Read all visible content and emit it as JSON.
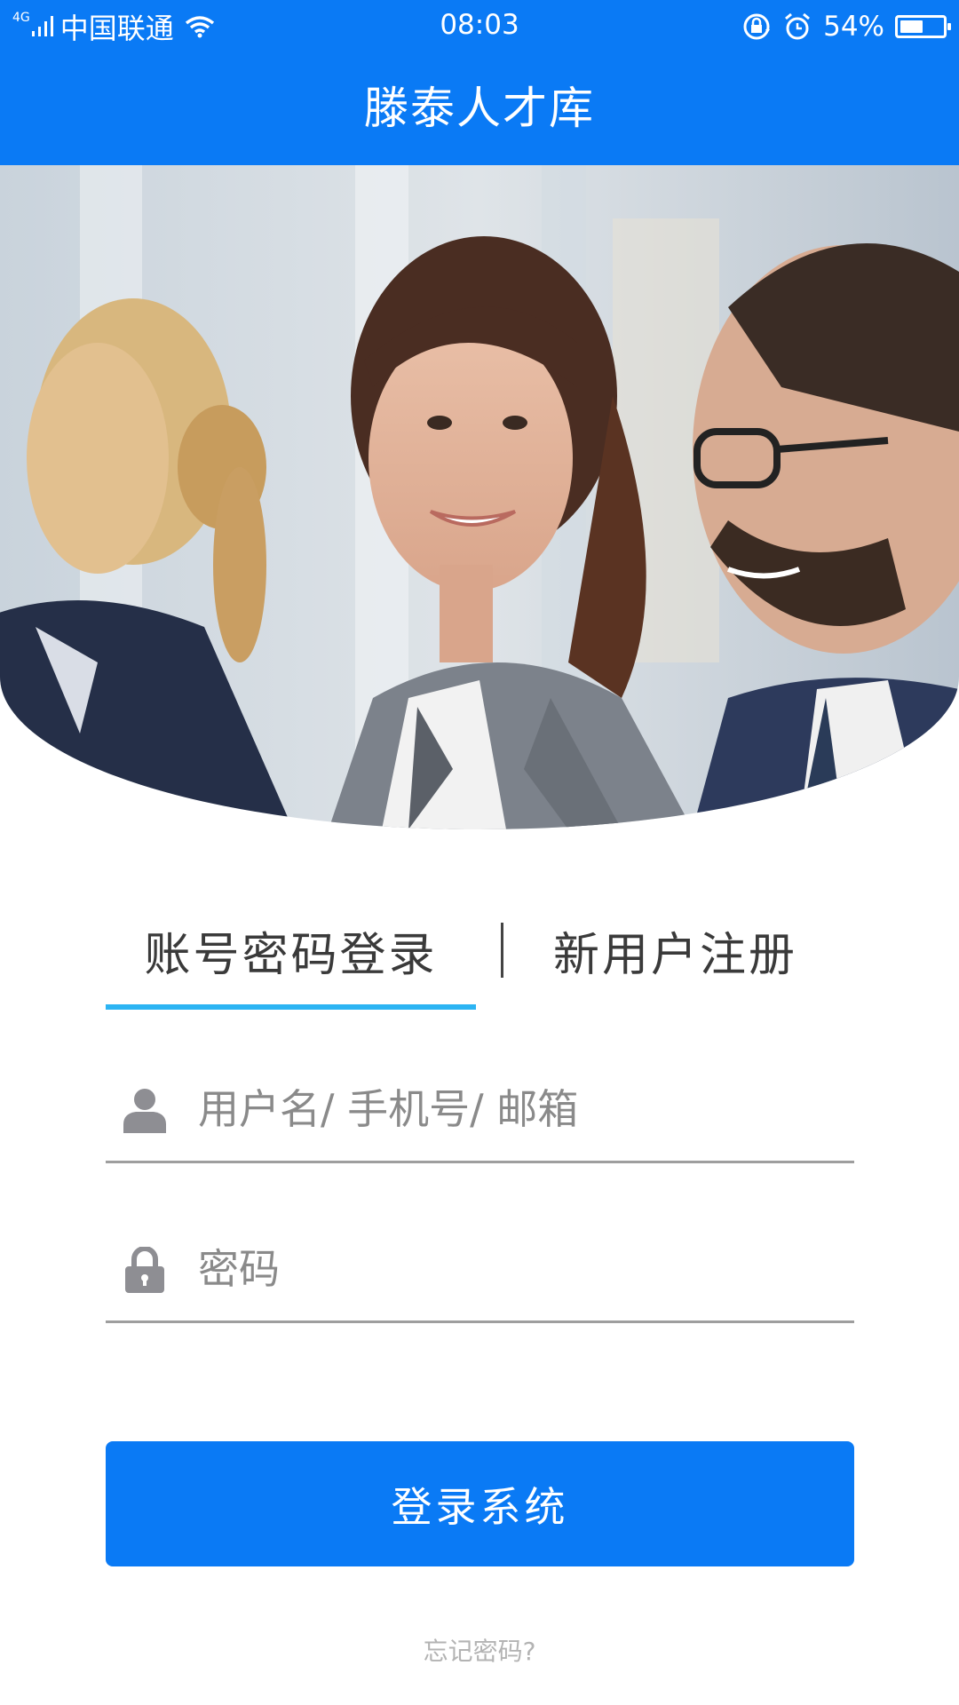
{
  "status_bar": {
    "network_type": "4G",
    "carrier": "中国联通",
    "time": "08:03",
    "battery_percent": "54%",
    "battery_level": 0.54
  },
  "app": {
    "title": "滕泰人才库"
  },
  "tabs": [
    {
      "label": "账号密码登录",
      "active": true
    },
    {
      "label": "新用户注册",
      "active": false
    }
  ],
  "form": {
    "username_placeholder": "用户名/ 手机号/ 邮箱",
    "password_placeholder": "密码",
    "login_button": "登录系统",
    "forgot_password": "忘记密码?"
  },
  "colors": {
    "primary": "#0a7af5",
    "tab_indicator": "#2cb4f3",
    "field_icon": "#8e8e93"
  }
}
